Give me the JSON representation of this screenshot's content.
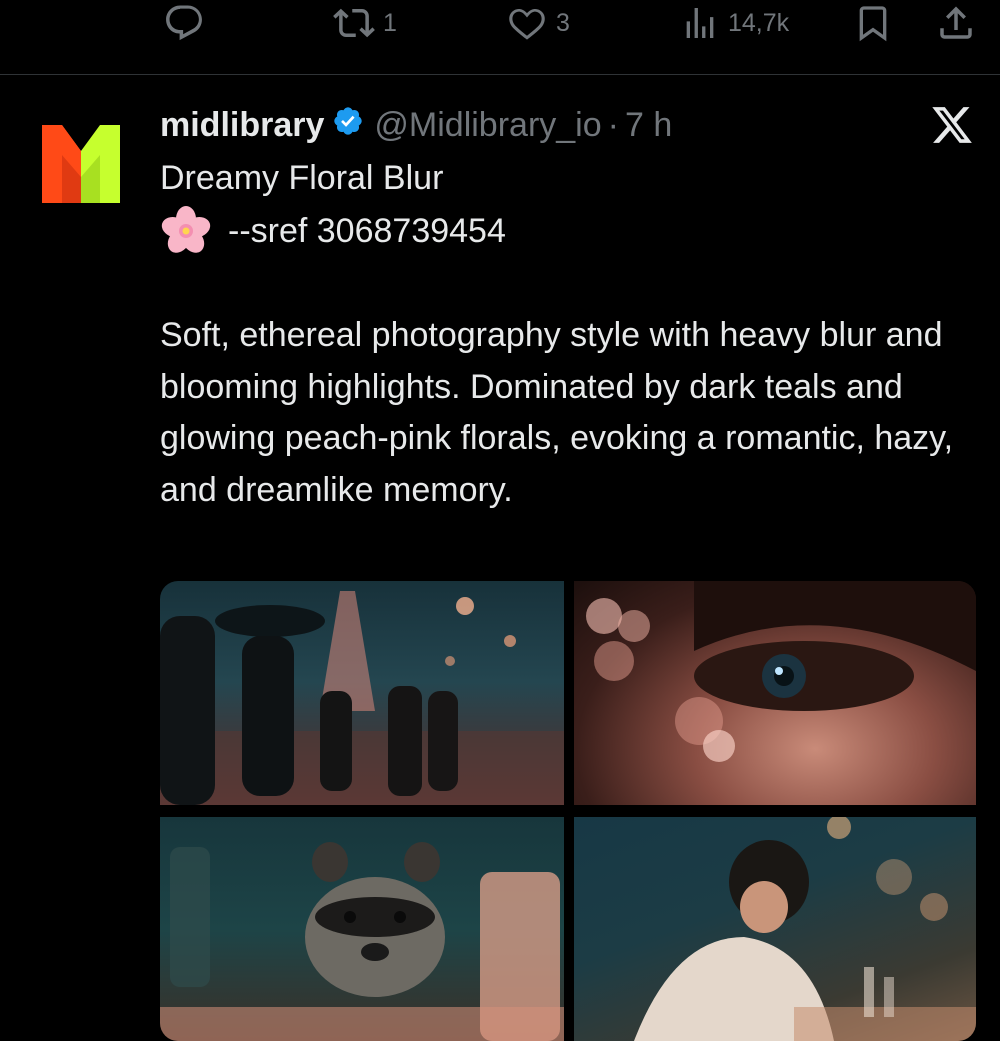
{
  "prev_tweet_actions": {
    "reply": {
      "icon": "reply-icon"
    },
    "retweet": {
      "icon": "retweet-icon",
      "count": "1"
    },
    "like": {
      "icon": "heart-icon",
      "count": "3"
    },
    "views": {
      "icon": "analytics-icon",
      "count": "14,7k"
    },
    "bookmark": {
      "icon": "bookmark-icon"
    },
    "share": {
      "icon": "share-icon"
    }
  },
  "tweet": {
    "avatar": {
      "letter": "M",
      "colors": [
        "#ff5a1f",
        "#c6ff2e"
      ]
    },
    "display_name": "midlibrary",
    "verified_icon": "verified-badge-icon",
    "handle": "@Midlibrary_io",
    "separator": "·",
    "time": "7 h",
    "platform_icon": "x-logo-icon",
    "title": "Dreamy Floral Blur",
    "sref_emoji": "cherry-blossom-icon",
    "sref": "--sref 3068739454",
    "description": "Soft, ethereal photography style with heavy blur and blooming highlights. Dominated by dark teals and glowing peach-pink florals, evoking a romantic, hazy, and dreamlike memory.",
    "media": [
      {
        "subject": "people-with-umbrellas-eiffel-tower-image"
      },
      {
        "subject": "eye-closeup-bokeh-image"
      },
      {
        "subject": "raccoon-at-table-image"
      },
      {
        "subject": "person-leaning-over-table-image"
      }
    ]
  },
  "colors": {
    "background": "#000000",
    "text_primary": "#e7e9ea",
    "text_secondary": "#71767b",
    "verified_blue": "#1d9bf0",
    "divider": "#2f3336"
  }
}
